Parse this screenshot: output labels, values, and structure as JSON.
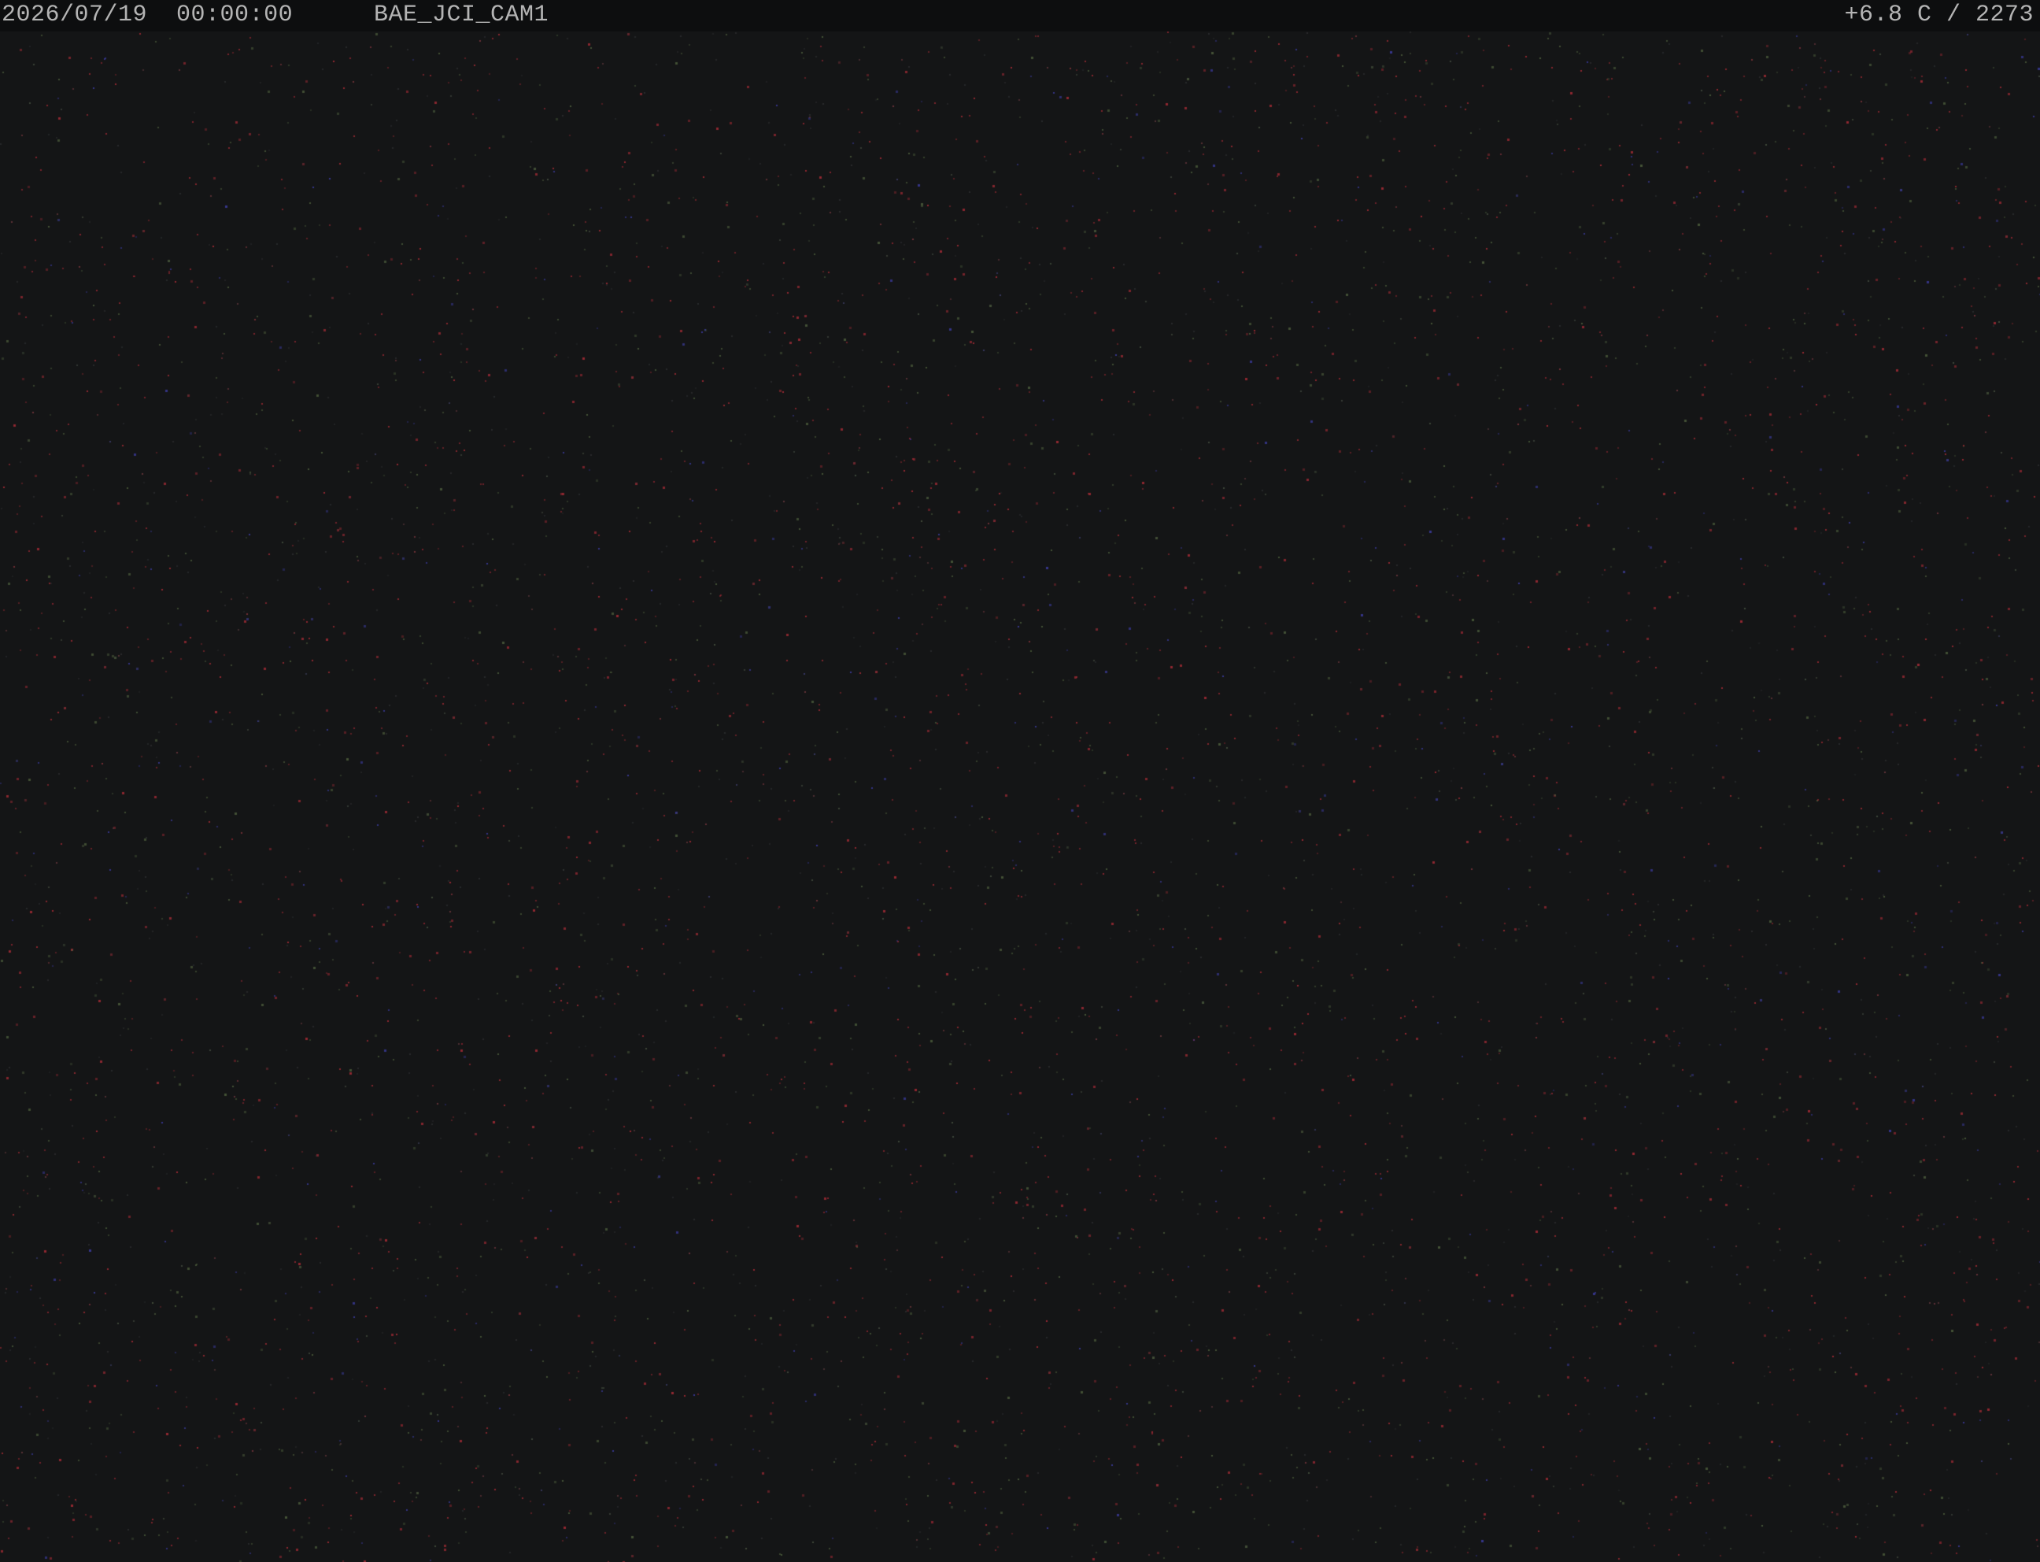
{
  "overlay": {
    "date": "2026/07/19",
    "time": "00:00:00",
    "camera_id": "BAE_JCI_CAM1",
    "temperature": "+6.8 C",
    "frame_value": "2273"
  },
  "colors": {
    "background": "#141516",
    "overlay_bar": "#0d0e0f",
    "overlay_text": "#b4b4b4",
    "noise_red": "#a02a34",
    "noise_green": "#4a5a3a",
    "noise_blue": "#3a3a9a"
  }
}
